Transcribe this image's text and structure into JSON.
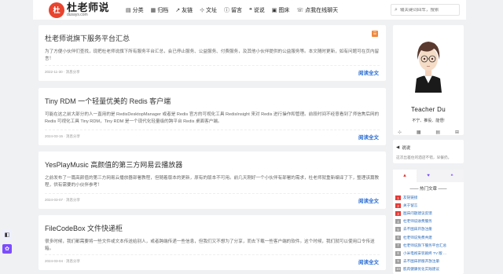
{
  "header": {
    "logo_mark": "杜",
    "logo_title": "杜老师说",
    "logo_sub": "dusays.com",
    "nav": [
      {
        "icon": "▤",
        "icon_name": "folder-icon",
        "label": "分类"
      },
      {
        "icon": "▦",
        "icon_name": "archive-icon",
        "label": "归档"
      },
      {
        "icon": "↗",
        "icon_name": "external-link-icon",
        "label": "友链"
      },
      {
        "icon": "⊹",
        "icon_name": "rss-icon",
        "label": "文址"
      },
      {
        "icon": "ⓘ",
        "icon_name": "info-icon",
        "label": "留言"
      },
      {
        "icon": "❝",
        "icon_name": "chat-icon",
        "label": "说说"
      },
      {
        "icon": "▣",
        "icon_name": "image-icon",
        "label": "图床"
      },
      {
        "icon": "☏",
        "icon_name": "phone-icon",
        "label": "点我在线聊天"
      }
    ],
    "search_placeholder": "输关键词回车，搜索"
  },
  "posts": [
    {
      "title": "杜老师说旗下服务平台汇总",
      "excerpt": "为了方便小伙伴们查找，现把杜老师说旗下所有服务平台汇总，会已停止服务、公益服务、付费服务，及其他小伙伴提供的公益服务等。本文随时更新，如有问题可在页内留言！",
      "meta": "2022-11-30 · 消息分享",
      "more": "阅读全文",
      "badge": "☰"
    },
    {
      "title": "Tiny RDM 一个轻量优美的 Redis 客户端",
      "excerpt": "可能在这之前大部分的人一直用的是 RedisDesktopManager 或者是 Redis 官方的可视化工具 RedisInsight 来对 Redis 进行操作和管理。前段时间不经意看到了师信焦后网的 Redis 可视化工具 Tiny RDM，Tiny RDM 是一个现代化轻量级的跨平台 Redis 桌面客户端。",
      "meta": "2024-03-15 · 消息分享",
      "more": "阅读全文"
    },
    {
      "title": "YesPlayMusic 高颜值的第三方网易云播放器",
      "excerpt": "之前发布了一篇高颜值的第三方网易云播放器部署教程，但随着版本的更新，原有的版本不可用。前几天刚好一个小伙伴有部署的需求，杜老师就重新编译了下，整理该篇教程，供有需要的小伙伴参考！",
      "meta": "2024-03-07 · 消息分享",
      "more": "阅读全文"
    },
    {
      "title": "FileCodeBox 文件快递柜",
      "excerpt": "很多时候，我们都需要将一些文件或文本传送给别人，或者跨端传递一些信息，但我们又不想为了分享，而去下载一些客户端的软件。这个时候，我们就可以使用口令传送箱。",
      "meta": "2024-03-04 · 消息分享",
      "more": "阅读全文"
    }
  ],
  "profile": {
    "name": "Teacher Du",
    "motto": "不宁、推役、能悟!",
    "links": [
      {
        "icon": "⊹",
        "name": "rss-icon"
      },
      {
        "icon": "▦",
        "name": "calendar-icon"
      },
      {
        "icon": "▤",
        "name": "book-icon"
      },
      {
        "icon": "⊞",
        "name": "sitemap-icon"
      }
    ]
  },
  "notice": {
    "title": "说说",
    "text": "这次出差住的酒店不错，早餐扔。"
  },
  "hot": {
    "tabs": [
      {
        "icon": "▲",
        "name": "tab-hot"
      },
      {
        "icon": "♥",
        "name": "tab-like"
      },
      {
        "icon": "❝",
        "name": "tab-comment"
      }
    ],
    "title": "—— 热门文章 ——",
    "items": [
      {
        "rank": "1",
        "color": "#e53935",
        "label": "友链链接"
      },
      {
        "rank": "2",
        "color": "#e53935",
        "label": "关于留言"
      },
      {
        "rank": "3",
        "color": "#e53935",
        "label": "图床问题建议反馈"
      },
      {
        "rank": "4",
        "color": "#9e9e9e",
        "label": "杜老师说收费服务"
      },
      {
        "rank": "5",
        "color": "#9e9e9e",
        "label": "去不图床开放注册"
      },
      {
        "rank": "6",
        "color": "#9e9e9e",
        "label": "杜老师说免费共建"
      },
      {
        "rank": "7",
        "color": "#9e9e9e",
        "label": "杜老师说旗下服务平台汇总"
      },
      {
        "rank": "8",
        "color": "#9e9e9e",
        "label": "小米电视安装剧终 TV 版 ..."
      },
      {
        "rank": "9",
        "color": "#9e9e9e",
        "label": "去不图床新版开放注册"
      },
      {
        "rank": "10",
        "color": "#9e9e9e",
        "label": "肌肉健康优化实践建议"
      }
    ]
  },
  "float": [
    {
      "icon": "◧",
      "name": "reading-mode-icon",
      "color": "#eef0ff",
      "fg": "#333"
    },
    {
      "icon": "✿",
      "name": "theme-icon",
      "color": "#7c4dff",
      "fg": "#fff"
    }
  ]
}
